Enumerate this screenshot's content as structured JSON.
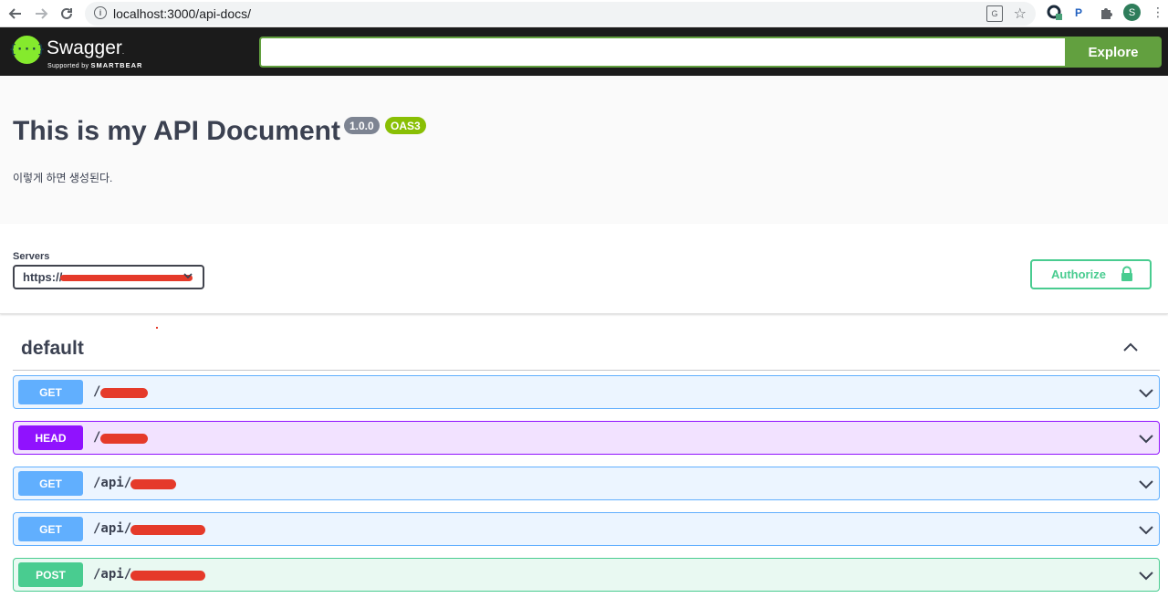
{
  "browser": {
    "url_host": "localhost",
    "url_rest": ":3000/api-docs/",
    "avatar_letter": "S"
  },
  "topbar": {
    "logo_mark": "{···}",
    "logo_name": "Swagger",
    "logo_tm": ".",
    "logo_sub_prefix": "Supported by ",
    "logo_sub_brand": "SMARTBEAR",
    "search_value": "",
    "explore_label": "Explore"
  },
  "info": {
    "title": "This is my API Document",
    "version": "1.0.0",
    "oas": "OAS3",
    "description": "이렇게 하면 생성된다."
  },
  "servers": {
    "label": "Servers",
    "selected_prefix": "https://"
  },
  "authorize": {
    "label": "Authorize"
  },
  "tag": {
    "name": "default"
  },
  "operations": [
    {
      "method": "GET",
      "path": "/"
    },
    {
      "method": "HEAD",
      "path": "/"
    },
    {
      "method": "GET",
      "path": "/api/"
    },
    {
      "method": "GET",
      "path": "/api/"
    },
    {
      "method": "POST",
      "path": "/api/"
    }
  ],
  "colors": {
    "get": "#61affe",
    "head": "#9012fe",
    "post": "#49cc90",
    "swagger_green": "#85ea2d",
    "explore_green": "#62a03f"
  }
}
